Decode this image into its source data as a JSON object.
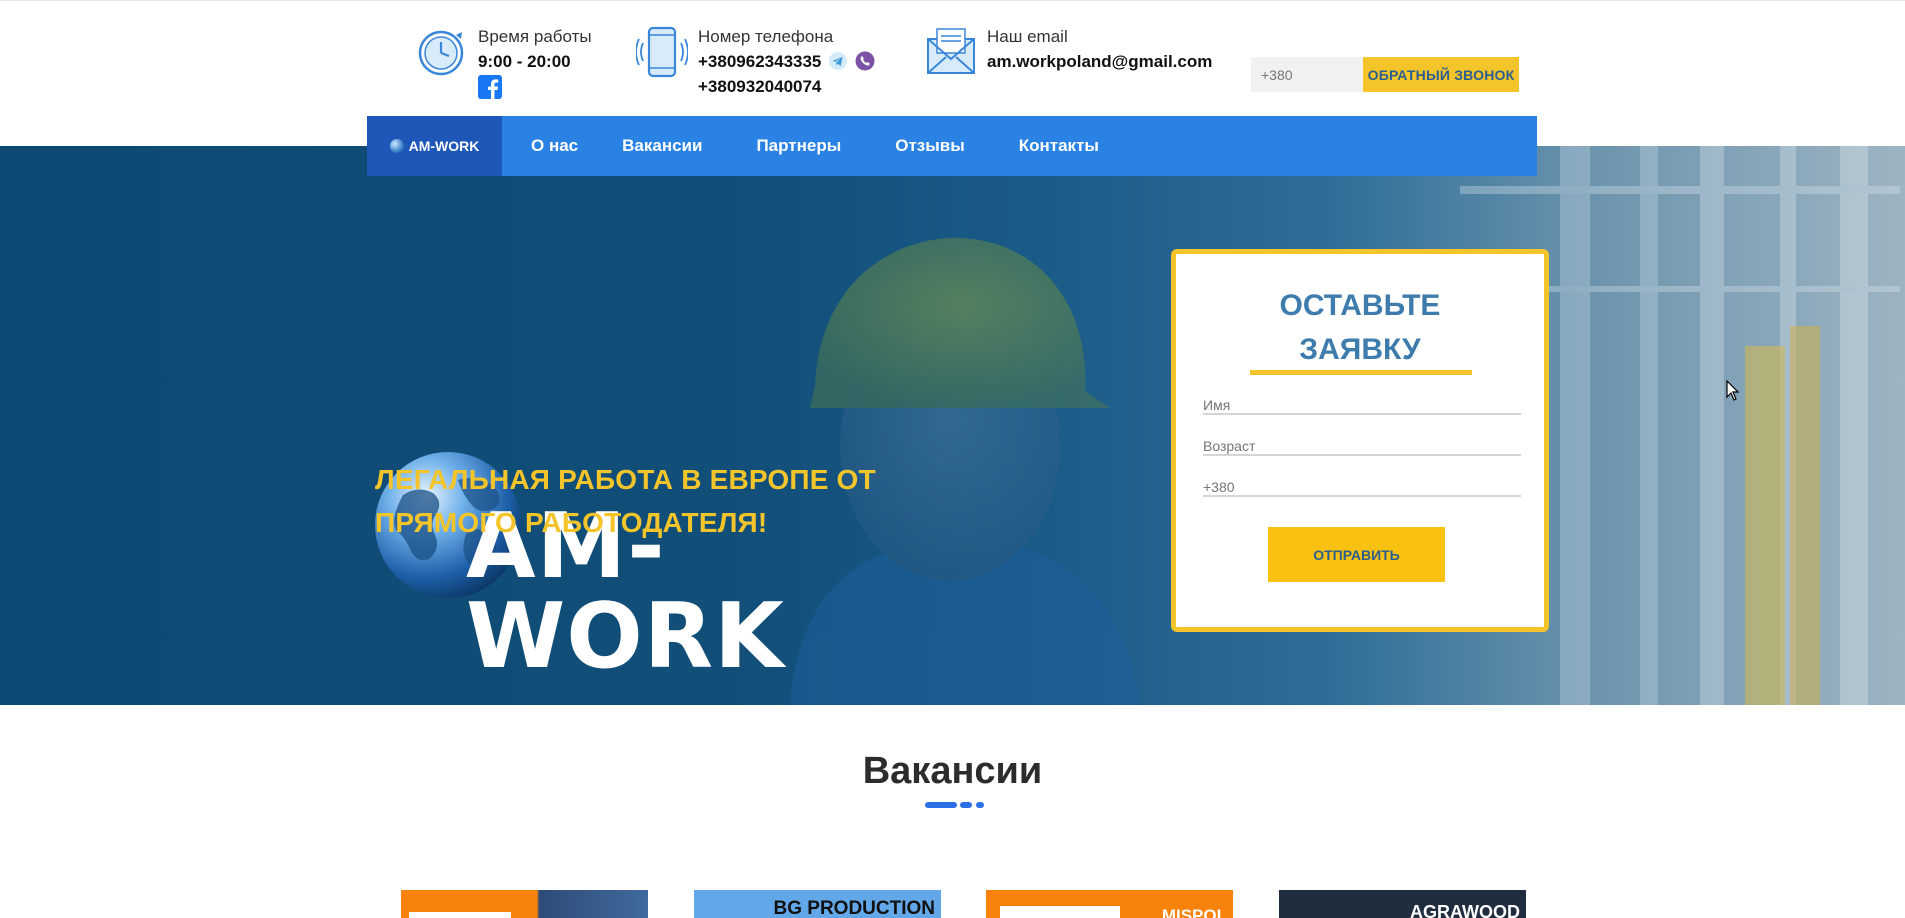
{
  "header": {
    "hours": {
      "label": "Время работы",
      "value": "9:00 - 20:00"
    },
    "phone": {
      "label": "Номер телефона",
      "number1": "+380962343335",
      "number2": "+380932040074"
    },
    "email": {
      "label": "Наш email",
      "value": "am.workpoland@gmail.com"
    },
    "callback": {
      "placeholder": "+380",
      "button_label": "ОБРАТНЫЙ ЗВОНОК"
    }
  },
  "nav": {
    "brand": "AM-WORK",
    "items": [
      "О нас",
      "Вакансии",
      "Партнеры",
      "Отзывы",
      "Контакты"
    ]
  },
  "hero": {
    "logo_text": "AM-WORK",
    "tagline_line1": "ЛЕГАЛЬНАЯ РАБОТА В ЕВРОПЕ ОТ",
    "tagline_line2": "ПРЯМОГО РАБОТОДАТЕЛЯ!"
  },
  "form": {
    "title_line1": "ОСТАВЬТЕ",
    "title_line2": "ЗАЯВКУ",
    "name_placeholder": "Имя",
    "age_placeholder": "Возраст",
    "phone_placeholder": "+380",
    "submit_label": "ОТПРАВИТЬ"
  },
  "vacancies": {
    "title": "Вакансии",
    "cards": [
      "",
      "BG PRODUCTION",
      "MISPOL",
      "AGRAWOOD"
    ]
  },
  "colors": {
    "nav_blue": "#2a83e4",
    "brand_blue": "#1e57b8",
    "accent_yellow": "#f4c42b",
    "hero_blue": "#114e78"
  }
}
